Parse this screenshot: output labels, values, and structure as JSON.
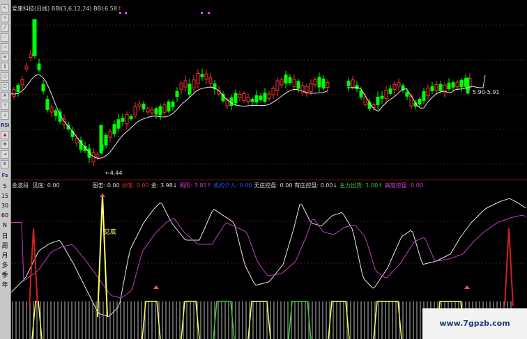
{
  "title_bar": {
    "stock": "爱康科技(日线)",
    "indicator": "BBI(3,6,12,24)",
    "bbi_label": "BBI:",
    "bbi_value": "6.58",
    "arrow": "↑"
  },
  "price_annotations": {
    "low_label": "←4.44",
    "right_label": "5.90-5.91"
  },
  "toolbar": {
    "labels": [
      "RSI",
      "Fs",
      "日",
      "周",
      "月",
      "多",
      "季",
      "年"
    ]
  },
  "indicator_axis": {
    "ticks": [
      "5",
      "15",
      "30",
      "60",
      "N"
    ]
  },
  "indicator_legend": {
    "name": "金波段",
    "items": [
      {
        "label": "见底: 0.00",
        "color": "#d8d8d8"
      },
      {
        "label": "图击: 0.00",
        "color": "#d8d8d8"
      },
      {
        "label": "抄底: 0.00",
        "color": "#e03030"
      },
      {
        "label": "金: 3.98↓",
        "color": "#d8d8d8"
      },
      {
        "label": "两阳: 3.85↑",
        "color": "#d040d0"
      },
      {
        "label": "机构介入: 0.00",
        "color": "#3050f0"
      },
      {
        "label": "无庄控盘: 0.00",
        "color": "#d8d8d8"
      },
      {
        "label": "有庄控盘: 0.00↓",
        "color": "#d8d8d8"
      },
      {
        "label": "主力出货: 1.00↑",
        "color": "#30d030"
      },
      {
        "label": "高度控盘: 0.00",
        "color": "#d040d0"
      }
    ]
  },
  "signals": {
    "bottom_label": "见底"
  },
  "watermark": "www.7gpzb.com",
  "colors": {
    "up": "#ff3232",
    "down": "#00ff00",
    "bbi": "#e8e8e8",
    "osc1": "#e8e8e8",
    "osc2": "#c040c0",
    "signal": "#ffff60",
    "marker": "#ff40ff"
  }
}
